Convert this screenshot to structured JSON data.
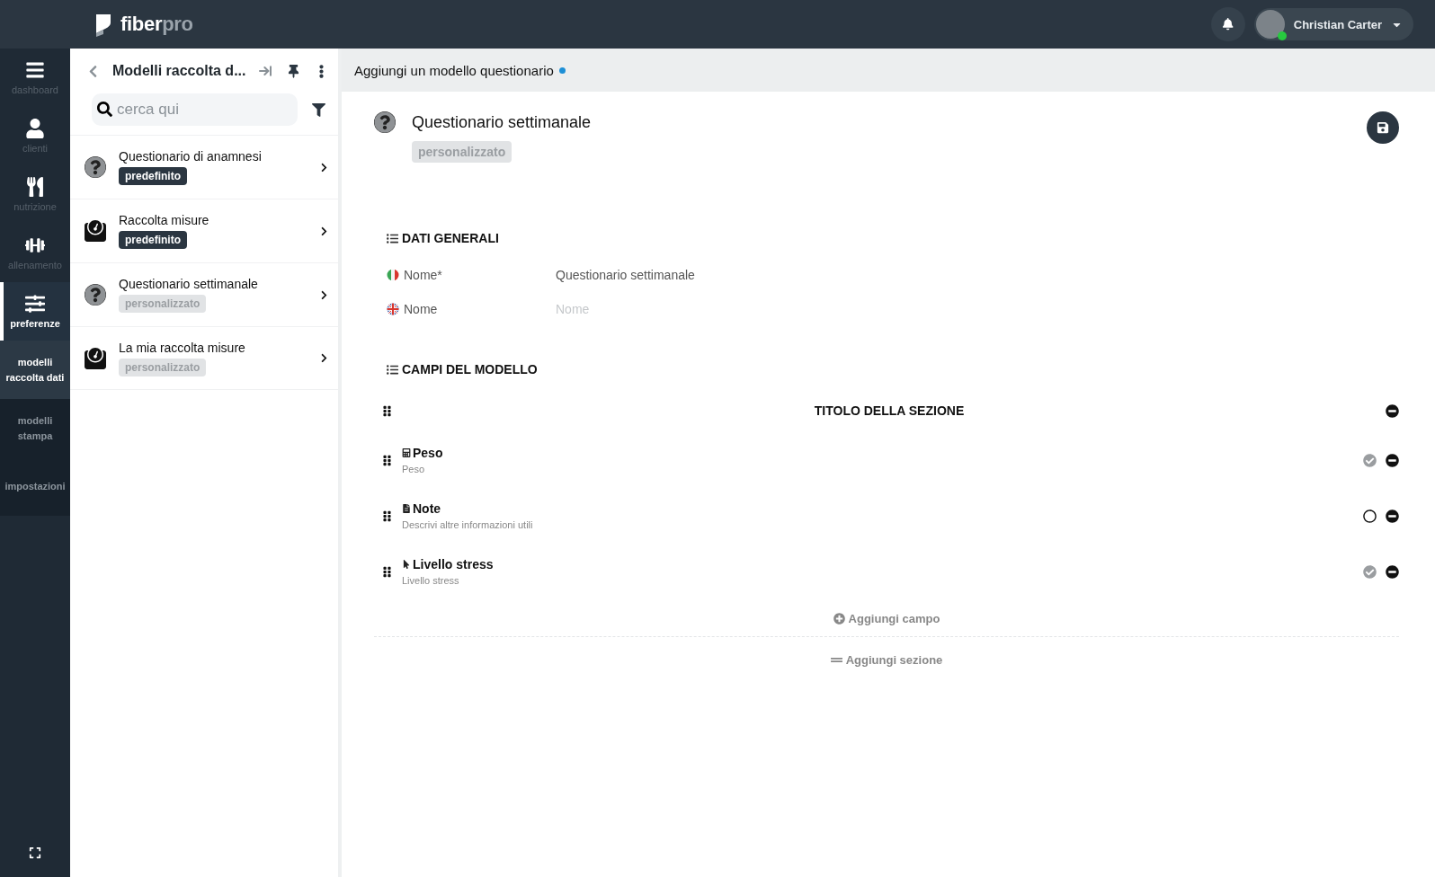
{
  "topbar": {
    "brand": {
      "main": "fiber",
      "accent": "pro"
    },
    "user": {
      "name": "Christian Carter",
      "online": true
    }
  },
  "nav": {
    "items": [
      {
        "kind": "main",
        "label": "dashboard",
        "selected": false
      },
      {
        "kind": "main",
        "label": "clienti",
        "selected": false
      },
      {
        "kind": "main",
        "label": "nutrizione",
        "selected": false
      },
      {
        "kind": "main",
        "label": "allenamento",
        "selected": false
      },
      {
        "kind": "main",
        "label": "preferenze",
        "selected": true
      },
      {
        "kind": "sub",
        "label": "modelli raccolta dati",
        "selected": true
      },
      {
        "kind": "sub",
        "label": "modelli stampa",
        "selected": false
      },
      {
        "kind": "sub",
        "label": "impostazioni",
        "selected": false
      }
    ]
  },
  "list_panel": {
    "title": "Modelli raccolta d...",
    "search": {
      "placeholder": "cerca qui"
    },
    "items": [
      {
        "title": "Questionario di anamnesi",
        "tag": "predefinito",
        "highlighted": true
      },
      {
        "title": "Raccolta misure",
        "tag": "predefinito",
        "highlighted": true
      },
      {
        "title": "Questionario settimanale",
        "tag": "personalizzato",
        "highlighted": false
      },
      {
        "title": "La mia raccolta misure",
        "tag": "personalizzato",
        "highlighted": false
      }
    ]
  },
  "main": {
    "header": {
      "title": "Aggiungi un modello questionario",
      "unsaved": true
    },
    "form": {
      "title": "Questionario settimanale",
      "tag": "personalizzato",
      "highlighted": false
    },
    "general": {
      "title": "DATI GENERALI",
      "fields": [
        {
          "label": "Nome*",
          "value": "Questionario settimanale"
        },
        {
          "label": "Nome",
          "placeholder": "Nome"
        }
      ]
    },
    "model": {
      "title": "CAMPI DEL MODELLO",
      "section_title": "TITOLO DELLA SEZIONE",
      "fields": [
        {
          "name": "Peso",
          "description": "Peso",
          "checked": true
        },
        {
          "name": "Note",
          "description": "Descrivi altre informazioni utili",
          "checked": false
        },
        {
          "name": "Livello stress",
          "description": "Livello stress",
          "checked": true
        }
      ],
      "add_field": "Aggiungi campo",
      "add_section": "Aggiungi sezione"
    }
  }
}
